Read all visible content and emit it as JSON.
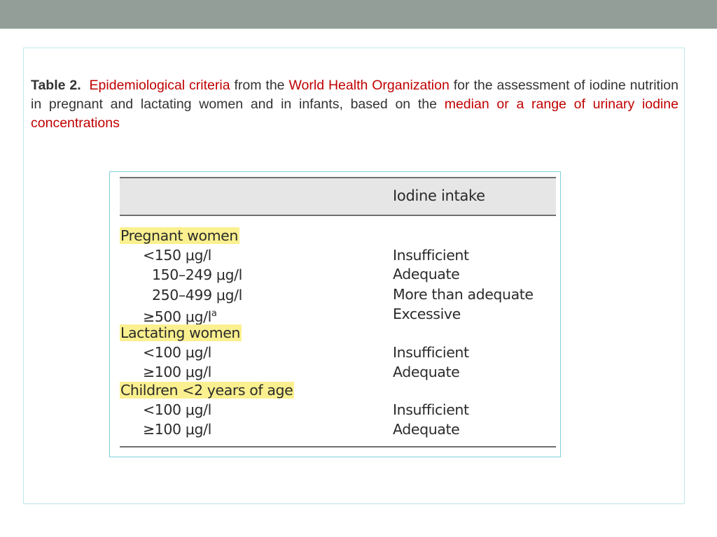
{
  "colors": {
    "top_bar": "#939e98",
    "caption_text": "#333333",
    "accent_red": "#c00000",
    "highlight": "#fbf08f"
  },
  "caption": {
    "label": "Table 2.",
    "part1": "Epidemiological criteria",
    "part2": " from the ",
    "part3": "World Health Organization",
    "part4": " for the assessment of iodine nutrition in pregnant and lactating women and in infants, based on the ",
    "part5": "median or a range of urinary iodine concentrations"
  },
  "table": {
    "header": "Iodine intake",
    "groups": [
      {
        "name": "Pregnant women",
        "rows": [
          {
            "range": "<150 μg/l",
            "intake": "Insufficient"
          },
          {
            "range": "150–249 μg/l",
            "intake": "Adequate"
          },
          {
            "range": "250–499 μg/l",
            "intake": "More than adequate"
          },
          {
            "range": "≥500 μg/l",
            "sup": "a",
            "intake": "Excessive"
          }
        ]
      },
      {
        "name": "Lactating women",
        "rows": [
          {
            "range": "<100 μg/l",
            "intake": "Insufficient"
          },
          {
            "range": "≥100 μg/l",
            "intake": "Adequate"
          }
        ]
      },
      {
        "name": "Children <2 years of age",
        "rows": [
          {
            "range": "<100 μg/l",
            "intake": "Insufficient"
          },
          {
            "range": "≥100 μg/l",
            "intake": "Adequate"
          }
        ]
      }
    ]
  }
}
